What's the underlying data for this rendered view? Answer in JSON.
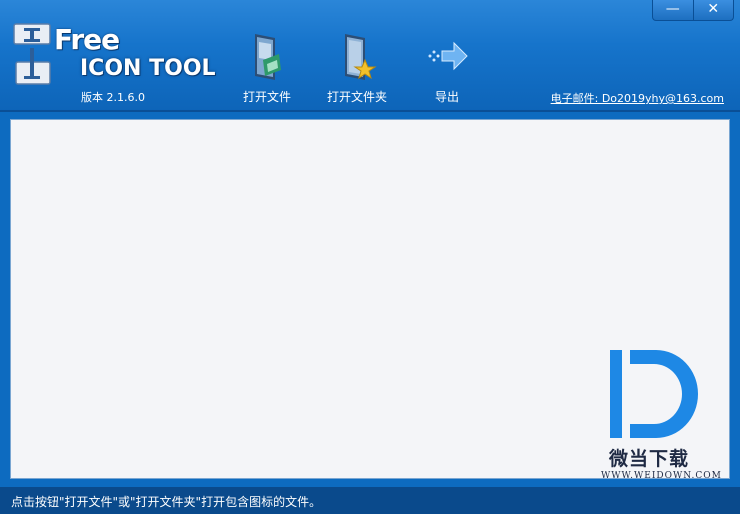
{
  "app": {
    "logo_free": "Free",
    "logo_title": "ICON TOOL",
    "version": "版本 2.1.6.0"
  },
  "window_controls": {
    "minimize": "—",
    "close": "✕"
  },
  "toolbar": {
    "open_file": "打开文件",
    "open_folder": "打开文件夹",
    "export": "导出"
  },
  "contact": {
    "email": "电子邮件: Do2019yhy@163.com"
  },
  "status": {
    "text": "点击按钮\"打开文件\"或\"打开文件夹\"打开包含图标的文件。"
  },
  "watermark": {
    "brand": "微当下载",
    "site": "WWW.WEIDOWN.COM"
  },
  "colors": {
    "header": "#1674cb",
    "status_bar": "#0a4a8c",
    "content_bg": "#f4f5f8",
    "watermark_blue": "#1e88e5"
  }
}
